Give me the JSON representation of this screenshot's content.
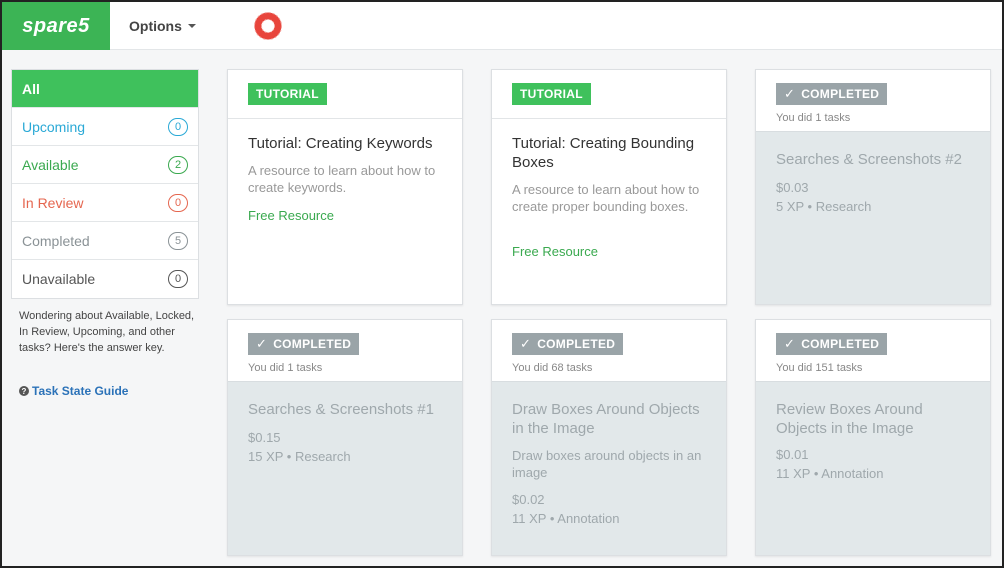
{
  "header": {
    "logo_text": "spare5",
    "options_label": "Options",
    "colors": {
      "brand": "#3cb455",
      "donut": "#e8453c"
    }
  },
  "sidebar": {
    "items": [
      {
        "label": "All",
        "count": ""
      },
      {
        "label": "Upcoming",
        "count": "0"
      },
      {
        "label": "Available",
        "count": "2"
      },
      {
        "label": "In Review",
        "count": "0"
      },
      {
        "label": "Completed",
        "count": "5"
      },
      {
        "label": "Unavailable",
        "count": "0"
      }
    ],
    "help_text": "Wondering about Available, Locked, In Review, Upcoming, and other tasks? Here's the answer key.",
    "guide_label": "Task State Guide"
  },
  "cards": [
    {
      "tag": "TUTORIAL",
      "title": "Tutorial: Creating Keywords",
      "description": "A resource to learn about how to create keywords.",
      "link": "Free Resource"
    },
    {
      "tag": "TUTORIAL",
      "title": "Tutorial: Creating Bounding Boxes",
      "description": "A resource to learn about how to create proper bounding boxes.",
      "link": "Free Resource"
    },
    {
      "tag": "COMPLETED",
      "did": "You did 1 tasks",
      "title": "Searches & Screenshots #2",
      "price": "$0.03",
      "xp": "5 XP • Research"
    },
    {
      "tag": "COMPLETED",
      "did": "You did 1 tasks",
      "title": "Searches & Screenshots #1",
      "price": "$0.15",
      "xp": "15 XP • Research"
    },
    {
      "tag": "COMPLETED",
      "did": "You did 68 tasks",
      "title": "Draw Boxes Around Objects in the Image",
      "description": "Draw boxes around objects in an image",
      "price": "$0.02",
      "xp": "11 XP • Annotation"
    },
    {
      "tag": "COMPLETED",
      "did": "You did 151 tasks",
      "title": "Review Boxes Around Objects in the Image",
      "price": "$0.01",
      "xp": "11 XP • Annotation"
    }
  ]
}
